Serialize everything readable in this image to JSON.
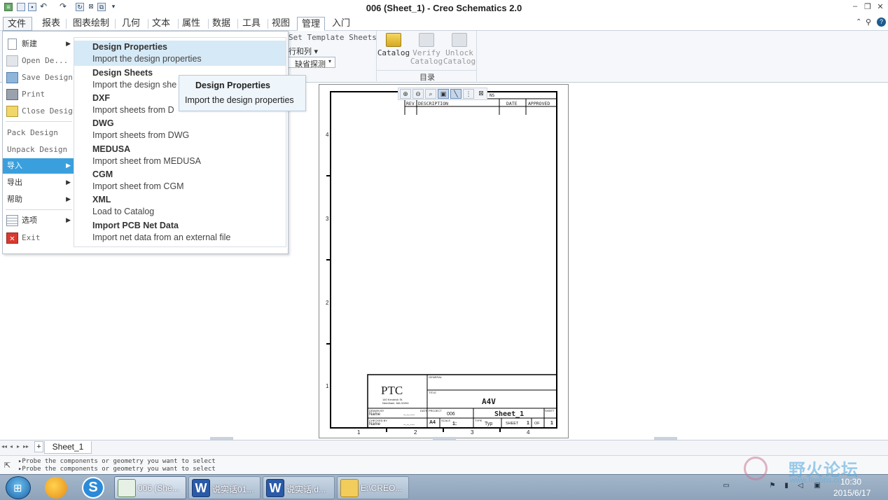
{
  "window": {
    "title": "006 (Sheet_1) - Creo Schematics 2.0",
    "controls": [
      "‒",
      "❐",
      "✕"
    ]
  },
  "quick_access": [
    "new-icon",
    "open-icon",
    "save-icon",
    "undo-icon",
    "redo-icon",
    "regenerate-icon",
    "close-icon",
    "window-icon",
    "customize-icon"
  ],
  "tabs": [
    {
      "label": "文件",
      "id": "file"
    },
    {
      "label": "报表",
      "id": "report"
    },
    {
      "label": "图表绘制",
      "id": "diagram"
    },
    {
      "label": "几何",
      "id": "geometry"
    },
    {
      "label": "文本",
      "id": "text"
    },
    {
      "label": "属性",
      "id": "properties"
    },
    {
      "label": "数据",
      "id": "data"
    },
    {
      "label": "工具",
      "id": "tools"
    },
    {
      "label": "视图",
      "id": "view"
    },
    {
      "label": "管理",
      "id": "manage"
    },
    {
      "label": "入门",
      "id": "start"
    }
  ],
  "ribbon": {
    "set_template_sheets": "Set Template Sheets",
    "rows_cols": "行和列 ▾",
    "default_probe": "缺省探测",
    "catalog": "Catalog",
    "verify_catalog_1": "Verify",
    "verify_catalog_2": "Catalog",
    "unlock_catalog_1": "Unlock",
    "unlock_catalog_2": "Catalog",
    "group_catalog": "目录"
  },
  "file_menu": {
    "items": [
      {
        "label": "新建",
        "icon": "new-file-icon",
        "arrow": true
      },
      {
        "label": "Open De...",
        "icon": "open-design-icon",
        "arrow": false
      },
      {
        "label": "Save Design",
        "icon": "save-design-icon",
        "arrow": false
      },
      {
        "label": "Print",
        "icon": "print-icon",
        "arrow": false
      },
      {
        "label": "Close Design",
        "icon": "close-design-icon",
        "arrow": false
      },
      {
        "label": "Pack Design",
        "icon": "",
        "arrow": false
      },
      {
        "label": "Unpack Design",
        "icon": "",
        "arrow": false
      },
      {
        "label": "导入",
        "icon": "",
        "arrow": true
      },
      {
        "label": "导出",
        "icon": "",
        "arrow": true
      },
      {
        "label": "帮助",
        "icon": "",
        "arrow": true
      },
      {
        "label": "选项",
        "icon": "options-icon",
        "arrow": true
      },
      {
        "label": "Exit",
        "icon": "exit-icon",
        "arrow": false
      }
    ],
    "submenu": [
      {
        "title": "Design Properties",
        "desc": "Import the design properties"
      },
      {
        "title": "Design Sheets",
        "desc": "Import the design she"
      },
      {
        "title": "DXF",
        "desc": "Import sheets from D"
      },
      {
        "title": "DWG",
        "desc": "Import sheets from DWG"
      },
      {
        "title": "MEDUSA",
        "desc": "Import sheet from MEDUSA"
      },
      {
        "title": "CGM",
        "desc": "Import sheet from CGM"
      },
      {
        "title": "XML",
        "desc": "Load to Catalog"
      },
      {
        "title": "Import PCB Net Data",
        "desc": "Import net data from an external file"
      }
    ]
  },
  "tooltip": {
    "title": "Design Properties",
    "desc": "Import the design properties"
  },
  "sheet": {
    "toolbar": [
      "zoom-in-icon",
      "zoom-out-icon",
      "zoom-area-icon",
      "zoom-fit-icon",
      "select-icon",
      "grid-icon",
      "close-icon"
    ],
    "rev_headers": [
      "REV",
      "DESCRIPTION",
      "DATE",
      "APPROVED"
    ],
    "rev_caption": "NS",
    "row_labels": [
      "4",
      "3",
      "2",
      "1"
    ],
    "col_labels": [
      "1",
      "2",
      "3",
      "4"
    ],
    "title_block": {
      "logo": "PTC",
      "address_1": "140 Kendrick St.",
      "address_2": "Needham, MA 02494",
      "drawn_by": "DRAWN BY",
      "checked_by": "CHECKED BY",
      "date": "DATE",
      "name1": "Name",
      "name2": "Name",
      "date1": "--.--.----",
      "date2": "--.--.----",
      "general": "GENERAL",
      "title_lbl": "TITLE",
      "title": "A4V",
      "project_lbl": "PROJECT",
      "project": "006",
      "sheet_name": "Sheet_1",
      "size": "A4",
      "scale_lbl": "SCALE",
      "scale": "1:",
      "type_lbl": "TYPE",
      "type": "Typ",
      "sheet_lbl": "SHEET",
      "sheet_no": "1",
      "of": "OF",
      "of_no": "1",
      "rev_lbl": "SHEET"
    }
  },
  "sheet_tabs": {
    "nav": [
      "◂◂",
      "◂",
      "▸",
      "▸▸"
    ],
    "add": "+",
    "tab": "Sheet_1"
  },
  "status": {
    "messages": [
      "▸Probe the components or geometry you want to select",
      "▸Probe the components or geometry you want to select"
    ]
  },
  "taskbar": {
    "tasks": [
      {
        "label": "006 (She...",
        "icon": "creo-icon"
      },
      {
        "label": "说实话01...",
        "icon": "word-icon"
      },
      {
        "label": "说实话.d...",
        "icon": "word-icon"
      },
      {
        "label": "E:\\CREO...",
        "icon": "folder-icon"
      }
    ],
    "time": "10:30",
    "date": "2015/6/17",
    "watermark": "野火论坛",
    "watermark_url": "www.firebbs.cn"
  }
}
